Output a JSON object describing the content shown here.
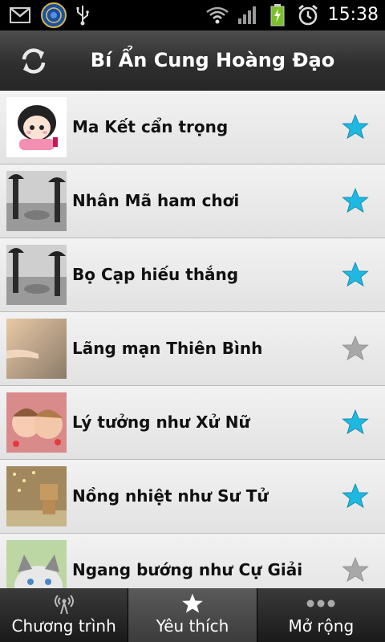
{
  "status_bar": {
    "time": "15:38",
    "icons": [
      "gmail-icon",
      "app-notification-icon",
      "usb-icon",
      "wifi-icon",
      "signal-icon",
      "battery-charging-icon",
      "alarm-icon"
    ]
  },
  "header": {
    "title": "Bí Ẩn Cung Hoàng Đạo",
    "refresh_icon": "refresh-icon"
  },
  "list": {
    "items": [
      {
        "label": "Ma Kết cẩn trọng",
        "favorite": true
      },
      {
        "label": "Nhân Mã ham chơi",
        "favorite": true
      },
      {
        "label": "Bọ Cạp hiếu thắng",
        "favorite": true
      },
      {
        "label": "Lãng mạn Thiên Bình",
        "favorite": false
      },
      {
        "label": "Lý tưởng như Xử Nữ",
        "favorite": true
      },
      {
        "label": "Nồng nhiệt như Sư Tử",
        "favorite": true
      },
      {
        "label": "Ngang bướng như Cự Giải",
        "favorite": false
      }
    ]
  },
  "tabs": [
    {
      "label": "Chương trình",
      "icon": "broadcast-icon",
      "selected": false
    },
    {
      "label": "Yêu thích",
      "icon": "star-icon",
      "selected": true
    },
    {
      "label": "Mở rộng",
      "icon": "more-icon",
      "selected": false
    }
  ],
  "colors": {
    "star_on": "#1fb8e0",
    "star_off": "#a8a8a8",
    "title_bar": "#3a3a3a",
    "row_bg": "#e9e9e9"
  }
}
